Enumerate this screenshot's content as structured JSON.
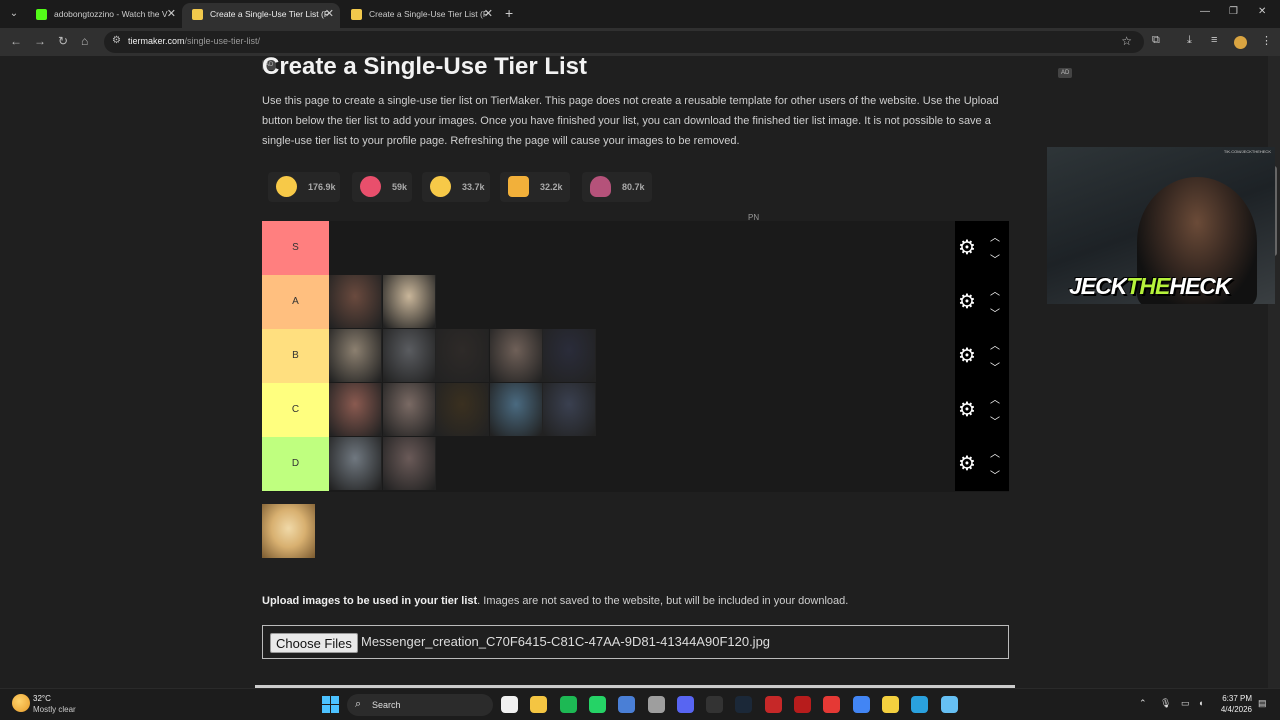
{
  "browser": {
    "tabs": [
      {
        "title": "adobongtozzino - Watch the V",
        "favicon_color": "#53fc18",
        "active": false
      },
      {
        "title": "Create a Single-Use Tier List (P",
        "favicon_color": "#f2c94c",
        "active": true
      },
      {
        "title": "Create a Single-Use Tier List (P",
        "favicon_color": "#f2c94c",
        "active": false
      }
    ],
    "new_tab": "+",
    "url_domain": "tiermaker.com",
    "url_path": "/single-use-tier-list/"
  },
  "page": {
    "ad_label": "AD",
    "title": "Create a Single-Use Tier List",
    "description": "Use this page to create a single-use tier list on TierMaker. This page does not create a reusable template for other users of the website. Use the Upload button below the tier list to add your images. Once you have finished your list, you can download the finished tier list image. It is not possible to save a single-use tier list to your profile page. Refreshing the page will cause your images to be removed.",
    "reactions": [
      {
        "count": "176.9k",
        "icon": "grinning-face-icon",
        "color": "#f7c948"
      },
      {
        "count": "59k",
        "icon": "heart-eyes-icon",
        "color": "#e94f6c"
      },
      {
        "count": "33.7k",
        "icon": "laughing-face-icon",
        "color": "#f7c948"
      },
      {
        "count": "32.2k",
        "icon": "raised-hands-icon",
        "color": "#f2b03a"
      },
      {
        "count": "80.7k",
        "icon": "poop-icon",
        "color": "#b5527a"
      }
    ],
    "pn_label": "PN",
    "tiers": [
      {
        "label": "S",
        "color": "#ff7f7f",
        "items": []
      },
      {
        "label": "A",
        "color": "#ffbf7f",
        "items": [
          "#6a4a3e",
          "#c9b69a"
        ]
      },
      {
        "label": "B",
        "color": "#ffdf7f",
        "items": [
          "#8c8070",
          "#5a5c60",
          "#2e2a28",
          "#6f6058",
          "#2a2c3a"
        ]
      },
      {
        "label": "C",
        "color": "#ffff7f",
        "items": [
          "#8a5a50",
          "#7a6a64",
          "#3a3020",
          "#4a6a80",
          "#3a4050"
        ]
      },
      {
        "label": "D",
        "color": "#bfff7f",
        "items": [
          "#707880",
          "#6a5a58"
        ]
      }
    ],
    "pool_item_color": "#d8b070",
    "upload_bold": "Upload images to be used in your tier list",
    "upload_rest": ". Images are not saved to the website, but will be included in your download.",
    "choose_files": "Choose Files",
    "file_name": "Messenger_creation_C70F6415-C81C-47AA-9D81-41344A90F120.jpg"
  },
  "overlay": {
    "logo_part1": "JECK",
    "logo_part2": "THE",
    "logo_part3": "HECK",
    "url": "TIK.COM/JECKTHEHECK"
  },
  "taskbar": {
    "temp": "32°C",
    "weather": "Mostly clear",
    "search_label": "Search",
    "time": "6:37 PM",
    "date": "4/4/2026",
    "apps": [
      "#f1f1f1",
      "#f4c542",
      "#1db954",
      "#25d366",
      "#4a7fd6",
      "#9e9e9e",
      "#5865f2",
      "#333333",
      "#1b2838",
      "#c62828",
      "#b71c1c",
      "#e53935",
      "#4285f4",
      "#f4d03f",
      "#2aa1de",
      "#66c0f4"
    ]
  }
}
